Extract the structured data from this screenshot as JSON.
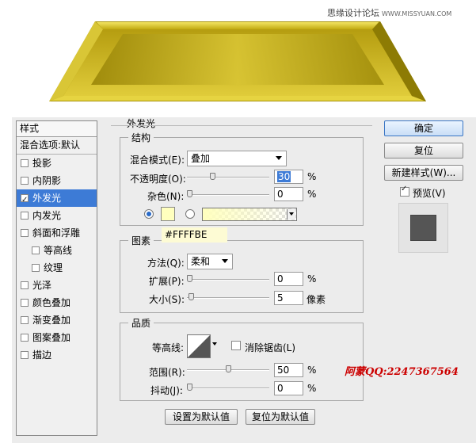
{
  "watermark": {
    "site": "思缘设计论坛",
    "url": "WWW.MISSYUAN.COM"
  },
  "colors": {
    "glow": "#FFFFBE",
    "bevel_light": "#e8d44a",
    "bevel_dark": "#8b7a05",
    "selection": "#3d7bd6"
  },
  "style_list": {
    "header": "样式",
    "blending": "混合选项:默认",
    "items": [
      {
        "label": "投影",
        "checked": false,
        "selected": false,
        "sub": false
      },
      {
        "label": "内阴影",
        "checked": false,
        "selected": false,
        "sub": false
      },
      {
        "label": "外发光",
        "checked": true,
        "selected": true,
        "sub": false
      },
      {
        "label": "内发光",
        "checked": false,
        "selected": false,
        "sub": false
      },
      {
        "label": "斜面和浮雕",
        "checked": false,
        "selected": false,
        "sub": false
      },
      {
        "label": "等高线",
        "checked": false,
        "selected": false,
        "sub": true
      },
      {
        "label": "纹理",
        "checked": false,
        "selected": false,
        "sub": true
      },
      {
        "label": "光泽",
        "checked": false,
        "selected": false,
        "sub": false
      },
      {
        "label": "颜色叠加",
        "checked": false,
        "selected": false,
        "sub": false
      },
      {
        "label": "渐变叠加",
        "checked": false,
        "selected": false,
        "sub": false
      },
      {
        "label": "图案叠加",
        "checked": false,
        "selected": false,
        "sub": false
      },
      {
        "label": "描边",
        "checked": false,
        "selected": false,
        "sub": false
      }
    ]
  },
  "panel": {
    "title": "外发光",
    "structure": {
      "legend": "结构",
      "blend_mode_label": "混合模式(E):",
      "blend_mode_value": "叠加",
      "opacity_label": "不透明度(O):",
      "opacity_value": "30",
      "opacity_level": 30,
      "noise_label": "杂色(N):",
      "noise_value": "0",
      "noise_level": 0,
      "unit_percent": "%"
    },
    "tooltip_hex": "#FFFFBE",
    "elements": {
      "legend": "图素",
      "technique_label": "方法(Q):",
      "technique_value": "柔和",
      "spread_label": "扩展(P):",
      "spread_value": "0",
      "spread_level": 0,
      "size_label": "大小(S):",
      "size_value": "5",
      "size_level": 2,
      "unit_percent": "%",
      "unit_px": "像素"
    },
    "quality": {
      "legend": "品质",
      "contour_label": "等高线:",
      "antialias_label": "消除锯齿(L)",
      "range_label": "范围(R):",
      "range_value": "50",
      "range_level": 50,
      "jitter_label": "抖动(J):",
      "jitter_value": "0",
      "jitter_level": 0,
      "unit_percent": "%"
    },
    "set_default": "设置为默认值",
    "reset_default": "复位为默认值"
  },
  "buttons": {
    "ok": "确定",
    "reset": "复位",
    "new_style": "新建样式(W)...",
    "preview_label": "预览(V)",
    "preview_checked": true
  },
  "annotation": "阿蒙QQ:2247367564"
}
